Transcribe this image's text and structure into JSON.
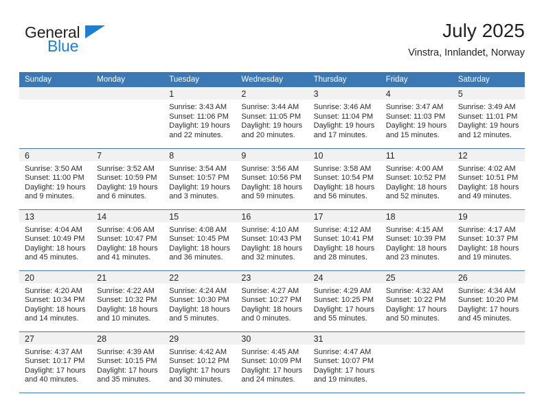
{
  "brand": {
    "name_top": "General",
    "name_bottom": "Blue",
    "accent_color": "#1c7fd4",
    "triangle_icon": "logo-triangle-icon"
  },
  "header": {
    "title": "July 2025",
    "subtitle": "Vinstra, Innlandet, Norway"
  },
  "theme": {
    "header_blue": "#3c78b4",
    "daynum_gray": "#f1f1f1",
    "text": "#231f20"
  },
  "calendar": {
    "weekday_headers": [
      "Sunday",
      "Monday",
      "Tuesday",
      "Wednesday",
      "Thursday",
      "Friday",
      "Saturday"
    ],
    "weeks": [
      [
        {
          "day": "",
          "lines": []
        },
        {
          "day": "",
          "lines": []
        },
        {
          "day": "1",
          "lines": [
            "Sunrise: 3:43 AM",
            "Sunset: 11:06 PM",
            "Daylight: 19 hours",
            "and 22 minutes."
          ]
        },
        {
          "day": "2",
          "lines": [
            "Sunrise: 3:44 AM",
            "Sunset: 11:05 PM",
            "Daylight: 19 hours",
            "and 20 minutes."
          ]
        },
        {
          "day": "3",
          "lines": [
            "Sunrise: 3:46 AM",
            "Sunset: 11:04 PM",
            "Daylight: 19 hours",
            "and 17 minutes."
          ]
        },
        {
          "day": "4",
          "lines": [
            "Sunrise: 3:47 AM",
            "Sunset: 11:03 PM",
            "Daylight: 19 hours",
            "and 15 minutes."
          ]
        },
        {
          "day": "5",
          "lines": [
            "Sunrise: 3:49 AM",
            "Sunset: 11:01 PM",
            "Daylight: 19 hours",
            "and 12 minutes."
          ]
        }
      ],
      [
        {
          "day": "6",
          "lines": [
            "Sunrise: 3:50 AM",
            "Sunset: 11:00 PM",
            "Daylight: 19 hours",
            "and 9 minutes."
          ]
        },
        {
          "day": "7",
          "lines": [
            "Sunrise: 3:52 AM",
            "Sunset: 10:59 PM",
            "Daylight: 19 hours",
            "and 6 minutes."
          ]
        },
        {
          "day": "8",
          "lines": [
            "Sunrise: 3:54 AM",
            "Sunset: 10:57 PM",
            "Daylight: 19 hours",
            "and 3 minutes."
          ]
        },
        {
          "day": "9",
          "lines": [
            "Sunrise: 3:56 AM",
            "Sunset: 10:56 PM",
            "Daylight: 18 hours",
            "and 59 minutes."
          ]
        },
        {
          "day": "10",
          "lines": [
            "Sunrise: 3:58 AM",
            "Sunset: 10:54 PM",
            "Daylight: 18 hours",
            "and 56 minutes."
          ]
        },
        {
          "day": "11",
          "lines": [
            "Sunrise: 4:00 AM",
            "Sunset: 10:52 PM",
            "Daylight: 18 hours",
            "and 52 minutes."
          ]
        },
        {
          "day": "12",
          "lines": [
            "Sunrise: 4:02 AM",
            "Sunset: 10:51 PM",
            "Daylight: 18 hours",
            "and 49 minutes."
          ]
        }
      ],
      [
        {
          "day": "13",
          "lines": [
            "Sunrise: 4:04 AM",
            "Sunset: 10:49 PM",
            "Daylight: 18 hours",
            "and 45 minutes."
          ]
        },
        {
          "day": "14",
          "lines": [
            "Sunrise: 4:06 AM",
            "Sunset: 10:47 PM",
            "Daylight: 18 hours",
            "and 41 minutes."
          ]
        },
        {
          "day": "15",
          "lines": [
            "Sunrise: 4:08 AM",
            "Sunset: 10:45 PM",
            "Daylight: 18 hours",
            "and 36 minutes."
          ]
        },
        {
          "day": "16",
          "lines": [
            "Sunrise: 4:10 AM",
            "Sunset: 10:43 PM",
            "Daylight: 18 hours",
            "and 32 minutes."
          ]
        },
        {
          "day": "17",
          "lines": [
            "Sunrise: 4:12 AM",
            "Sunset: 10:41 PM",
            "Daylight: 18 hours",
            "and 28 minutes."
          ]
        },
        {
          "day": "18",
          "lines": [
            "Sunrise: 4:15 AM",
            "Sunset: 10:39 PM",
            "Daylight: 18 hours",
            "and 23 minutes."
          ]
        },
        {
          "day": "19",
          "lines": [
            "Sunrise: 4:17 AM",
            "Sunset: 10:37 PM",
            "Daylight: 18 hours",
            "and 19 minutes."
          ]
        }
      ],
      [
        {
          "day": "20",
          "lines": [
            "Sunrise: 4:20 AM",
            "Sunset: 10:34 PM",
            "Daylight: 18 hours",
            "and 14 minutes."
          ]
        },
        {
          "day": "21",
          "lines": [
            "Sunrise: 4:22 AM",
            "Sunset: 10:32 PM",
            "Daylight: 18 hours",
            "and 10 minutes."
          ]
        },
        {
          "day": "22",
          "lines": [
            "Sunrise: 4:24 AM",
            "Sunset: 10:30 PM",
            "Daylight: 18 hours",
            "and 5 minutes."
          ]
        },
        {
          "day": "23",
          "lines": [
            "Sunrise: 4:27 AM",
            "Sunset: 10:27 PM",
            "Daylight: 18 hours",
            "and 0 minutes."
          ]
        },
        {
          "day": "24",
          "lines": [
            "Sunrise: 4:29 AM",
            "Sunset: 10:25 PM",
            "Daylight: 17 hours",
            "and 55 minutes."
          ]
        },
        {
          "day": "25",
          "lines": [
            "Sunrise: 4:32 AM",
            "Sunset: 10:22 PM",
            "Daylight: 17 hours",
            "and 50 minutes."
          ]
        },
        {
          "day": "26",
          "lines": [
            "Sunrise: 4:34 AM",
            "Sunset: 10:20 PM",
            "Daylight: 17 hours",
            "and 45 minutes."
          ]
        }
      ],
      [
        {
          "day": "27",
          "lines": [
            "Sunrise: 4:37 AM",
            "Sunset: 10:17 PM",
            "Daylight: 17 hours",
            "and 40 minutes."
          ]
        },
        {
          "day": "28",
          "lines": [
            "Sunrise: 4:39 AM",
            "Sunset: 10:15 PM",
            "Daylight: 17 hours",
            "and 35 minutes."
          ]
        },
        {
          "day": "29",
          "lines": [
            "Sunrise: 4:42 AM",
            "Sunset: 10:12 PM",
            "Daylight: 17 hours",
            "and 30 minutes."
          ]
        },
        {
          "day": "30",
          "lines": [
            "Sunrise: 4:45 AM",
            "Sunset: 10:09 PM",
            "Daylight: 17 hours",
            "and 24 minutes."
          ]
        },
        {
          "day": "31",
          "lines": [
            "Sunrise: 4:47 AM",
            "Sunset: 10:07 PM",
            "Daylight: 17 hours",
            "and 19 minutes."
          ]
        },
        {
          "day": "",
          "lines": []
        },
        {
          "day": "",
          "lines": []
        }
      ]
    ]
  }
}
